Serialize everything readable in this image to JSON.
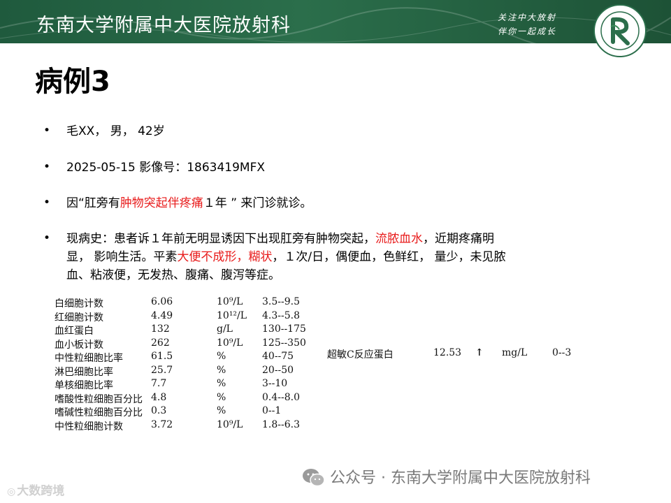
{
  "banner": {
    "title": "东南大学附属中大医院放射科",
    "slogan_line1": "关注中大放射",
    "slogan_line2": "伴你一起成长"
  },
  "heading": "病例3",
  "bullets": {
    "patient": "毛XX，  男，  42岁",
    "date_image": "2025-05-15    影像号：1863419MFX",
    "chief_pre": "因“肛旁有",
    "chief_red": "肿物突起伴疼痛",
    "chief_post": "１年 ”  来门诊就诊。",
    "hx_1a": "现病史：患者诉１年前无明显诱因下出现肛旁有肿物突起，",
    "hx_1b": "流脓血水",
    "hx_1c": "，近期疼痛明",
    "hx_2a": "显， 影响生活。平素",
    "hx_2b": "大便不成形，糊状",
    "hx_2c": "，１次/日，偶便血，色鲜红， 量少，未见脓",
    "hx_3": "血、粘液便，无发热、腹痛、腹泻等症。"
  },
  "lab_table": [
    {
      "name": "白细胞计数",
      "value": "6.06",
      "unit": "10⁹/L",
      "range": "3.5--9.5"
    },
    {
      "name": "红细胞计数",
      "value": "4.49",
      "unit": "10¹²/L",
      "range": "4.3--5.8"
    },
    {
      "name": "血红蛋白",
      "value": "132",
      "unit": "g/L",
      "range": "130--175"
    },
    {
      "name": "血小板计数",
      "value": "262",
      "unit": "10⁹/L",
      "range": "125--350"
    },
    {
      "name": "中性粒细胞比率",
      "value": "61.5",
      "unit": "%",
      "range": "40--75"
    },
    {
      "name": "淋巴细胞比率",
      "value": "25.7",
      "unit": "%",
      "range": "20--50"
    },
    {
      "name": "单核细胞比率",
      "value": "7.7",
      "unit": "%",
      "range": "3--10"
    },
    {
      "name": "嗜酸性粒细胞百分比",
      "value": "4.8",
      "unit": "%",
      "range": "0.4--8.0"
    },
    {
      "name": "嗜碱性粒细胞百分比",
      "value": "0.3",
      "unit": "%",
      "range": "0--1"
    },
    {
      "name": "中性粒细胞计数",
      "value": "3.72",
      "unit": "10⁹/L",
      "range": "1.8--6.3"
    }
  ],
  "crp": {
    "name": "超敏C反应蛋白",
    "value": "12.53",
    "arrow": "↑",
    "unit": "mg/L",
    "range": "0--3"
  },
  "footer": "公众号 · 东南大学附属中大医院放射科",
  "watermark": "大数跨境",
  "colors": {
    "banner": "#2b6e4b",
    "highlight": "#e81b1b"
  }
}
